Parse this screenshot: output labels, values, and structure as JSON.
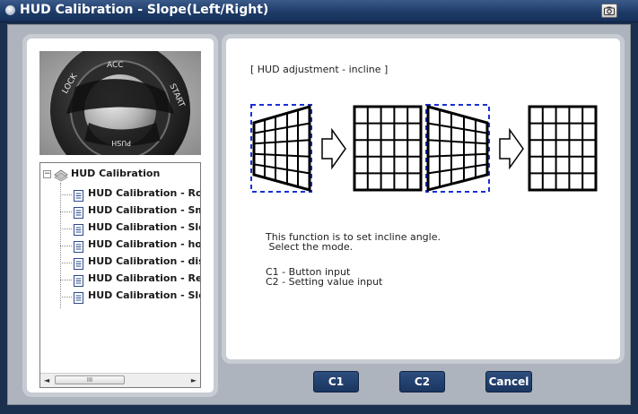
{
  "window": {
    "title": "HUD Calibration - Slope(Left/Right)"
  },
  "tree": {
    "root_label": "HUD Calibration",
    "items": [
      {
        "label": "HUD Calibration - Ro"
      },
      {
        "label": "HUD Calibration - Sm"
      },
      {
        "label": "HUD Calibration - Slo"
      },
      {
        "label": "HUD Calibration - hor"
      },
      {
        "label": "HUD Calibration - dis"
      },
      {
        "label": "HUD Calibration - Re"
      },
      {
        "label": "HUD Calibration - Slo"
      }
    ],
    "scroll_grip": "III"
  },
  "photo": {
    "ring_text": [
      "LOCK",
      "ACC",
      "START",
      "PUSH"
    ]
  },
  "content": {
    "header": "[ HUD adjustment - incline ]",
    "description_line1": "This function is to set incline angle.",
    "description_line2": " Select the mode.",
    "option_c1": "C1 - Button input",
    "option_c2": "C2 - Setting value input"
  },
  "buttons": {
    "c1": "C1",
    "c2": "C2",
    "cancel": "Cancel"
  },
  "icons": {
    "title": "window-icon",
    "camera": "camera-icon",
    "root": "folder-diamond-icon",
    "doc": "document-icon",
    "arrow": "right-arrow-icon"
  },
  "colors": {
    "title_bar": "#1d3a66",
    "button": "#1a3560",
    "dashed_frame": "#1a2fd6"
  }
}
